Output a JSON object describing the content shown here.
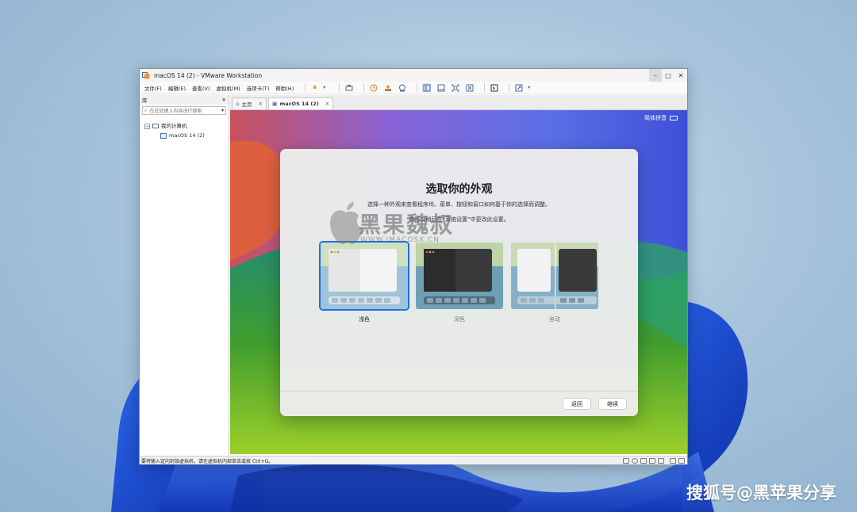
{
  "desktop": {
    "watermark": "搜狐号@黑苹果分享"
  },
  "window": {
    "title": "macOS 14 (2) - VMware Workstation",
    "controls": {
      "minimize": "–",
      "maximize": "□",
      "close": "✕"
    }
  },
  "menu": {
    "items": [
      "文件(F)",
      "编辑(E)",
      "查看(V)",
      "虚拟机(M)",
      "选项卡(T)",
      "帮助(H)"
    ]
  },
  "toolbar": {
    "icons": [
      "pause-icon",
      "dropdown-icon",
      "send-keys-icon",
      "snapshot-icon",
      "revert-snapshot-icon",
      "snapshot-manager-icon",
      "library-view-icon",
      "thumbnail-view-icon",
      "fullscreen-icon",
      "unity-icon",
      "console-icon",
      "stretch-icon"
    ],
    "pause_glyph": "⏸",
    "dropdown_glyph": "▾"
  },
  "library": {
    "title": "库",
    "close": "✕",
    "search_placeholder": "在此处键入内容进行搜索",
    "search_glyph": "⌕",
    "dropdown_glyph": "▾",
    "tree": {
      "root_expander": "⊟",
      "root_label": "我的计算机",
      "child_label": "macOS 14 (2)"
    }
  },
  "tabs": [
    {
      "label": "主页",
      "icon": "home-icon",
      "glyph": "⌂",
      "close": "✕"
    },
    {
      "label": "macOS 14 (2)",
      "icon": "vm-icon",
      "glyph": "▣",
      "close": "✕"
    }
  ],
  "guest": {
    "ime_label": "简体拼音",
    "dialog": {
      "title": "选取你的外观",
      "subtitle1": "选择一种外观来查看程序坞、菜单、按钮和窗口如何基于你的选择而调整。",
      "subtitle2": "你可以稍后在“系统设置”中更改此设置。",
      "options": [
        {
          "label": "浅色",
          "selected": true
        },
        {
          "label": "深色",
          "selected": false
        },
        {
          "label": "自动",
          "selected": false
        }
      ],
      "back_label": "返回",
      "continue_label": "继续"
    },
    "overlay_watermark": {
      "brand": "黑果魏叔",
      "url": "WWW.IMACOSX.CN"
    }
  },
  "statusbar": {
    "message": "要将输入定向到该虚拟机，请在虚拟机内部单击或按 Ctrl+G。"
  },
  "colors": {
    "accent": "#1f6fe5",
    "pause": "#f08a1c",
    "win_blue": "#1447c9"
  }
}
